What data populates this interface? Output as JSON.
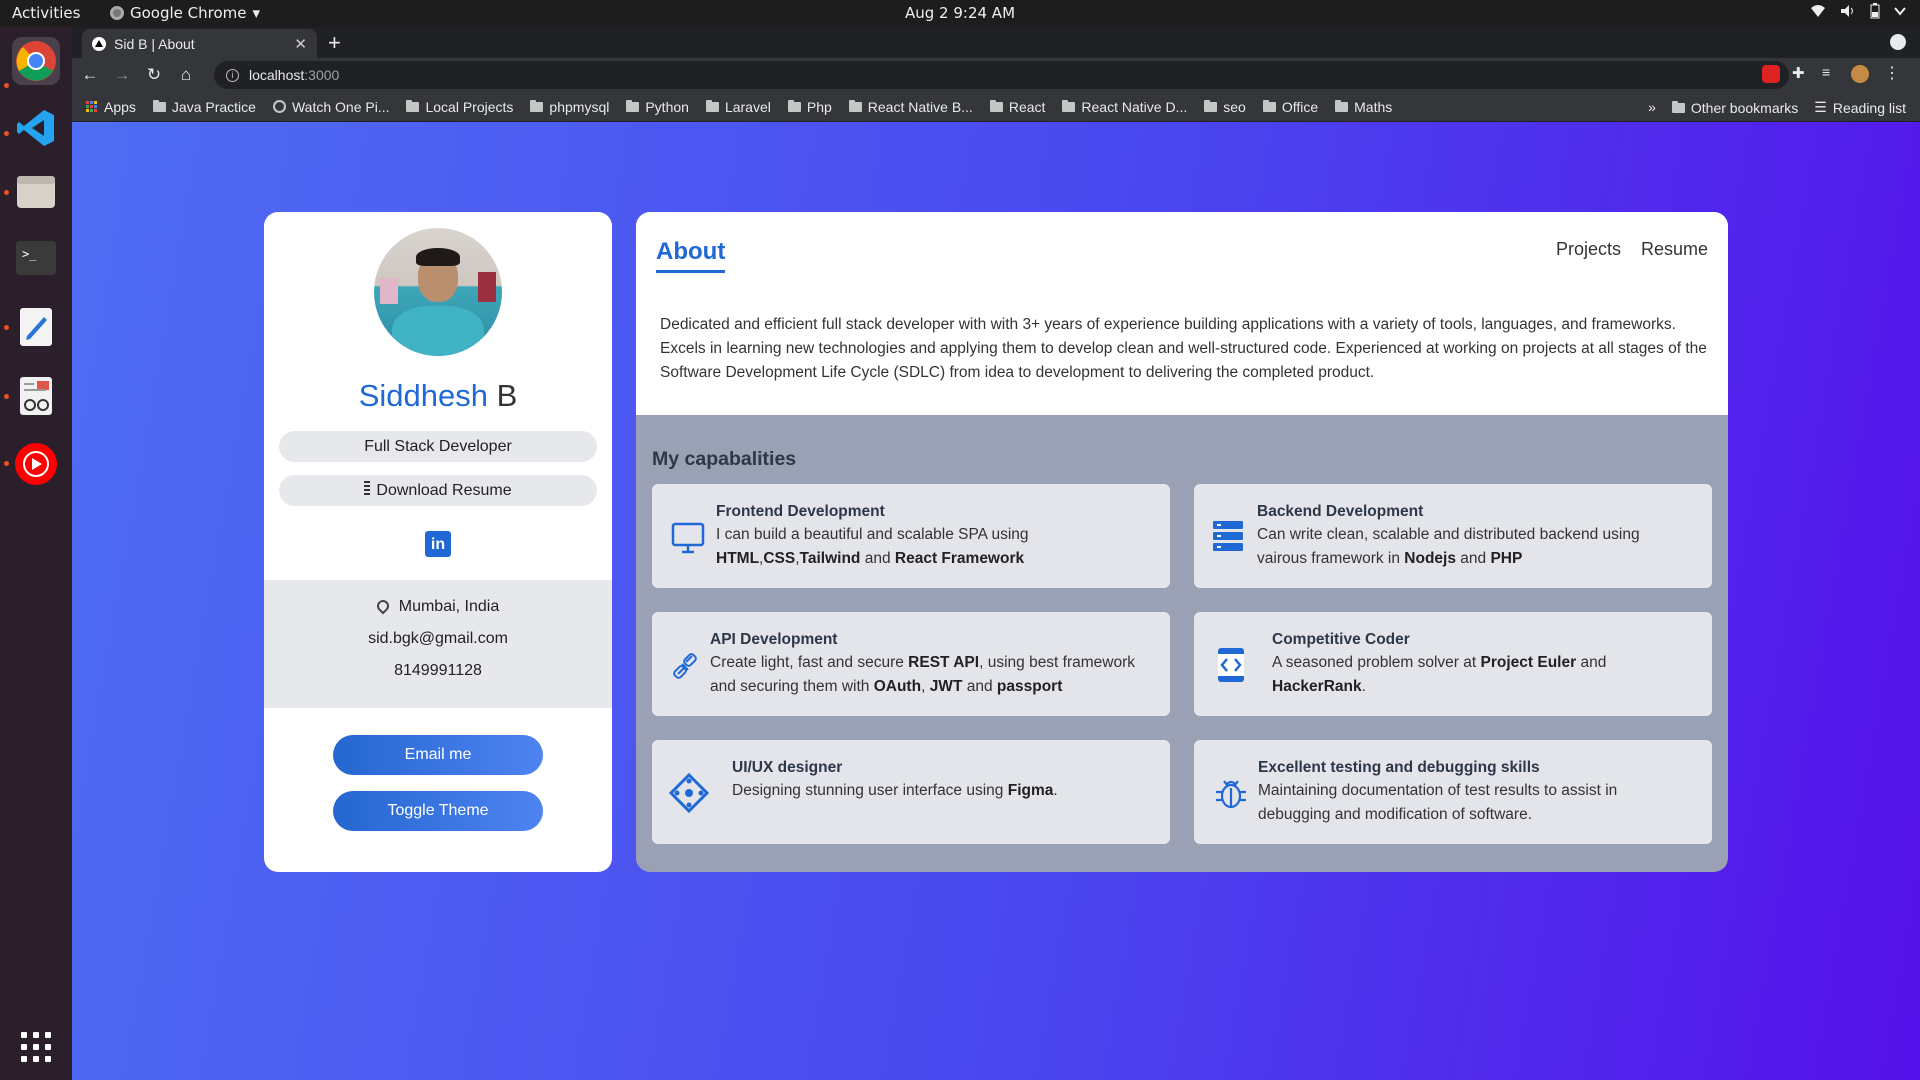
{
  "os": {
    "activities": "Activities",
    "app_name": "Google Chrome",
    "clock": "Aug 2  9:24 AM"
  },
  "browser": {
    "tab_title": "Sid B | About",
    "url_host": "localhost",
    "url_port": ":3000",
    "bookmarks": [
      "Apps",
      "Java Practice",
      "Watch One Pi...",
      "Local Projects",
      "phpmysql",
      "Python",
      "Laravel",
      "Php",
      "React Native B...",
      "React",
      "React Native D...",
      "seo",
      "Office",
      "Maths"
    ],
    "overflow": "»",
    "other_bookmarks": "Other bookmarks",
    "reading_list": "Reading list"
  },
  "profile": {
    "first_name": "Siddhesh",
    "last_name": "B",
    "role": "Full Stack Developer",
    "download": "Download Resume",
    "linkedin": "in",
    "location": "Mumbai, India",
    "email": "sid.bgk@gmail.com",
    "phone": "8149991128",
    "email_button": "Email me",
    "theme_button": "Toggle Theme"
  },
  "about": {
    "title": "About",
    "nav": [
      "Projects",
      "Resume"
    ],
    "description": "Dedicated and efficient full stack developer with with 3+ years of experience building applications with a variety of tools, languages, and frameworks. Excels in learning new technologies and applying them to develop clean and well-structured code. Experienced at working on projects at all stages of the Software Development Life Cycle (SDLC) from idea to development to delivering the completed product.",
    "capabilities_title": "My capabalities",
    "capabilities": [
      {
        "title": "Frontend Development",
        "icon": "monitor-icon",
        "parts": [
          [
            "I can build a beautiful and scalable SPA using ",
            ""
          ],
          [
            "HTML",
            "b"
          ],
          [
            ",",
            ""
          ],
          [
            "CSS",
            "b"
          ],
          [
            ",",
            ""
          ],
          [
            "Tailwind",
            "b"
          ],
          [
            " and ",
            ""
          ],
          [
            "React Framework",
            "b"
          ]
        ]
      },
      {
        "title": "Backend Development",
        "icon": "server-icon",
        "parts": [
          [
            "Can write clean, scalable and distributed backend using vairous framework in ",
            ""
          ],
          [
            "Nodejs",
            "b"
          ],
          [
            " and ",
            ""
          ],
          [
            "PHP",
            "b"
          ]
        ]
      },
      {
        "title": "API Development",
        "icon": "link-icon",
        "parts": [
          [
            "Create light, fast and secure ",
            ""
          ],
          [
            "REST API",
            "b"
          ],
          [
            ", using best framework and securing them with ",
            ""
          ],
          [
            "OAuth",
            "b"
          ],
          [
            ", ",
            ""
          ],
          [
            "JWT",
            "b"
          ],
          [
            " and ",
            ""
          ],
          [
            "passport",
            "b"
          ]
        ]
      },
      {
        "title": "Competitive Coder",
        "icon": "code-icon",
        "parts": [
          [
            "A seasoned problem solver at ",
            ""
          ],
          [
            "Project Euler",
            "b"
          ],
          [
            " and ",
            ""
          ],
          [
            "HackerRank",
            "b"
          ],
          [
            ".",
            ""
          ]
        ]
      },
      {
        "title": "UI/UX designer",
        "icon": "design-icon",
        "parts": [
          [
            "Designing stunning user interface using ",
            ""
          ],
          [
            "Figma",
            "b"
          ],
          [
            ".",
            ""
          ]
        ]
      },
      {
        "title": "Excellent testing and debugging skills",
        "icon": "bug-icon",
        "parts": [
          [
            "Maintaining documentation of test results to assist in debugging and modification of software.",
            ""
          ]
        ]
      }
    ]
  },
  "colors": {
    "accent": "#1f68d6",
    "page_gradient_start": "#4f6df3",
    "page_gradient_end": "#5511ea"
  }
}
